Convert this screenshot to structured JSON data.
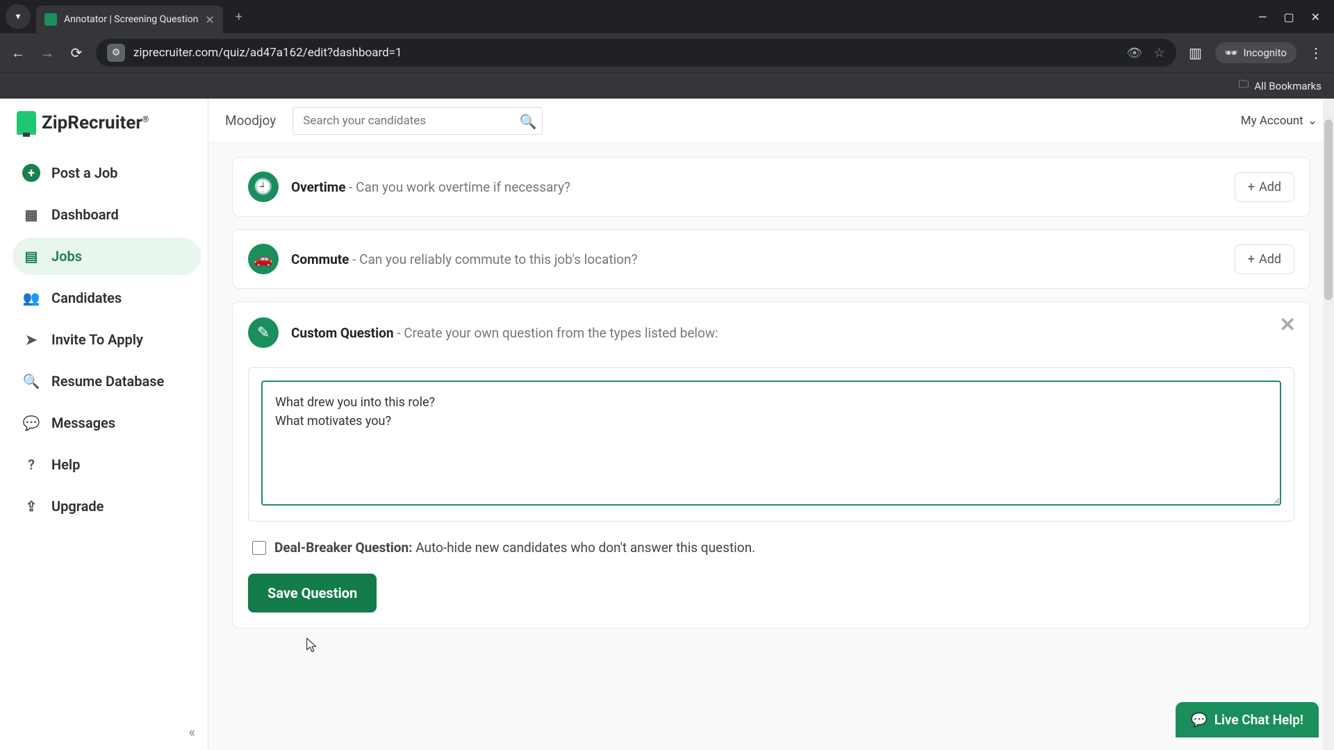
{
  "browser": {
    "tab_title": "Annotator | Screening Question",
    "url": "ziprecruiter.com/quiz/ad47a162/edit?dashboard=1",
    "incognito_label": "Incognito",
    "bookmarks_label": "All Bookmarks"
  },
  "brand": {
    "name": "ZipRecruiter"
  },
  "sidebar": {
    "items": [
      {
        "label": "Post a Job"
      },
      {
        "label": "Dashboard"
      },
      {
        "label": "Jobs"
      },
      {
        "label": "Candidates"
      },
      {
        "label": "Invite To Apply"
      },
      {
        "label": "Resume Database"
      },
      {
        "label": "Messages"
      },
      {
        "label": "Help"
      },
      {
        "label": "Upgrade"
      }
    ]
  },
  "topbar": {
    "org": "Moodjoy",
    "search_placeholder": "Search your candidates",
    "account_label": "My Account"
  },
  "questions": {
    "overtime": {
      "title": "Overtime",
      "desc": " - Can you work overtime if necessary?",
      "add": "Add"
    },
    "commute": {
      "title": "Commute",
      "desc": " - Can you reliably commute to this job's location?",
      "add": "Add"
    },
    "custom": {
      "title": "Custom Question",
      "desc": " - Create your own question from the types listed below:",
      "textarea_value": "What drew you into this role?\nWhat motivates you?",
      "dealbreaker_label": "Deal-Breaker Question:",
      "dealbreaker_desc": " Auto-hide new candidates who don't answer this question.",
      "save_label": "Save Question"
    }
  },
  "chat": {
    "label": "Live Chat Help!"
  }
}
